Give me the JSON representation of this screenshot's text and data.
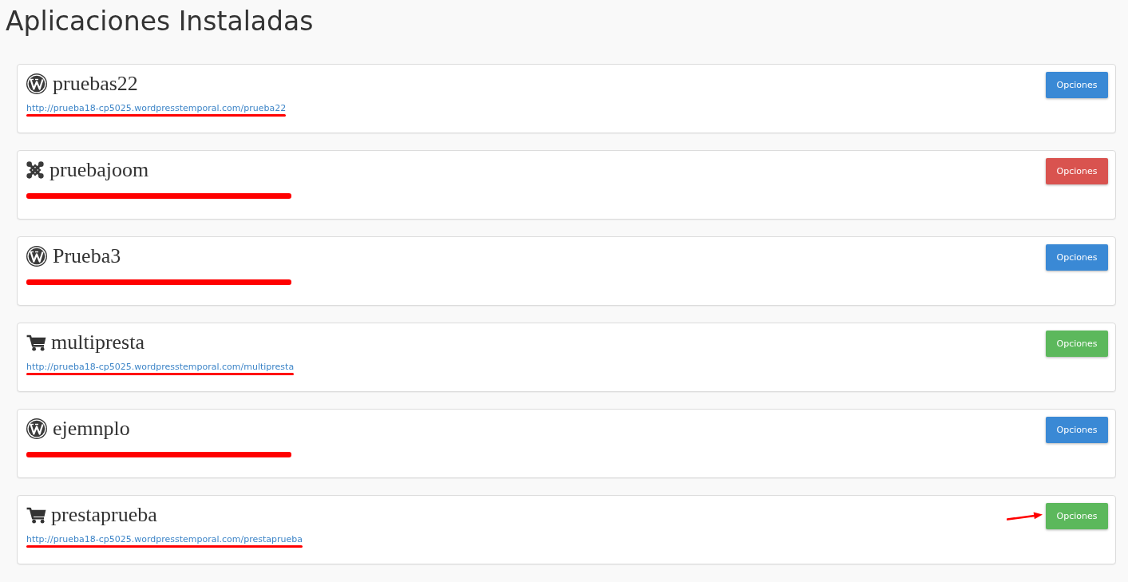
{
  "title": "Aplicaciones Instaladas",
  "apps": [
    {
      "name": "pruebas22",
      "kind": "wordpress",
      "link": {
        "kind": "struck",
        "url": "http://prueba18-cp5025.wordpresstemporal.com/prueba22"
      },
      "button": {
        "label": "Opciones",
        "color": "#3a89d5"
      },
      "pointed": false
    },
    {
      "name": "pruebajoom",
      "kind": "joomla",
      "link": {
        "kind": "covered"
      },
      "button": {
        "label": "Opciones",
        "color": "#d9534f"
      },
      "pointed": false
    },
    {
      "name": "Prueba3",
      "kind": "wordpress",
      "link": {
        "kind": "covered"
      },
      "button": {
        "label": "Opciones",
        "color": "#3a89d5"
      },
      "pointed": false
    },
    {
      "name": "multipresta",
      "kind": "prestashop",
      "link": {
        "kind": "struck",
        "url": "http://prueba18-cp5025.wordpresstemporal.com/multipresta"
      },
      "button": {
        "label": "Opciones",
        "color": "#5cb85c"
      },
      "pointed": false
    },
    {
      "name": "ejemnplo",
      "kind": "wordpress",
      "link": {
        "kind": "covered"
      },
      "button": {
        "label": "Opciones",
        "color": "#3a89d5"
      },
      "pointed": false
    },
    {
      "name": "prestaprueba",
      "kind": "prestashop",
      "link": {
        "kind": "struck",
        "url": "http://prueba18-cp5025.wordpresstemporal.com/prestaprueba"
      },
      "button": {
        "label": "Opciones",
        "color": "#5cb85c"
      },
      "pointed": true
    }
  ]
}
